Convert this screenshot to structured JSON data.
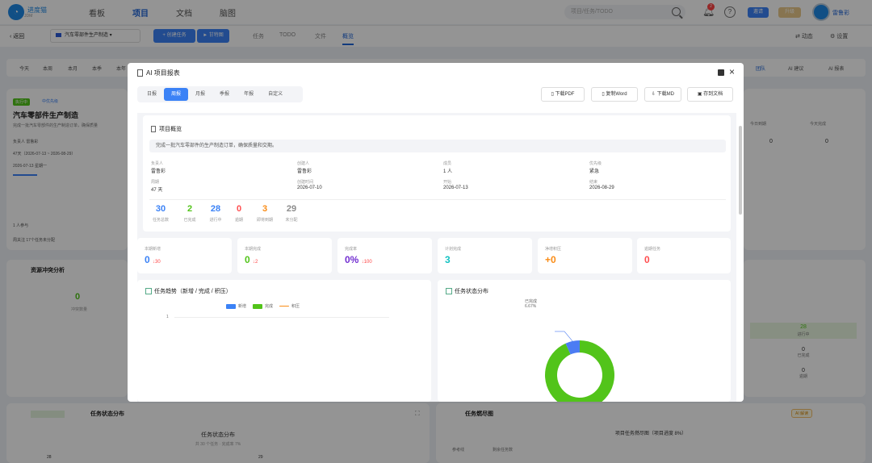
{
  "app": {
    "logo_text": "进度猫",
    "logo_sub": "JDM"
  },
  "nav": {
    "items": [
      "看板",
      "项目",
      "文档",
      "脑图"
    ],
    "active": 1,
    "search_placeholder": "项目/任务/TODO",
    "notif_count": "2",
    "btn_blue": "邀请",
    "btn_gold": "升级",
    "user_name": "雷鲁彩"
  },
  "toolbar": {
    "back": "返回",
    "project": "汽车零部件生产制造",
    "create_task": "+ 创建任务",
    "import": "► 甘特图",
    "tabs": [
      "任务",
      "TODO",
      "文件",
      "概览"
    ],
    "active_tab": 3,
    "right": [
      "动态",
      "设置"
    ]
  },
  "background": {
    "chips": [
      "今天",
      "本周",
      "本月",
      "本季",
      "本年"
    ],
    "right_chips": [
      "团队",
      "AI 建议",
      "AI 报表"
    ],
    "proj_status": "执行中",
    "proj_priority": "中优先级",
    "proj_name": "汽车零部件生产制造",
    "proj_desc": "完成一批汽车零部件的生产制造订单，确保质量",
    "owner_label": "负责人",
    "owner": "雷鲁彩",
    "duration": "47天（2026-07-13 ~ 2026-08-29）",
    "start": "2026-07-13 星期一",
    "members": "1 人参与",
    "focus": "周关注  17个任务未分配",
    "conflict_title": "资源冲突分析",
    "conflict_value": "0",
    "conflict_label": "冲突数量",
    "today_due": "今日到期",
    "today_done": "今天完成",
    "today_due_v": "0",
    "today_done_v": "0",
    "right_stats": [
      {
        "v": "28",
        "l": "进行中"
      },
      {
        "v": "0",
        "l": "已完成"
      },
      {
        "v": "0",
        "l": "逾期"
      }
    ],
    "status_title": "任务状态分布",
    "status_subtitle": "任务状态分布",
    "status_caption": "共 30 个任务 · 完成率 7%",
    "status_ticks": [
      "28",
      "29"
    ],
    "gantt_title": "任务燃尽图",
    "gantt_btn": "AI 解读",
    "gantt_subtitle": "项目任务燃尽图（项目进度 8%）",
    "gantt_legend": [
      "参考线",
      "剩余任务数"
    ]
  },
  "modal": {
    "title": "AI 项目报表",
    "tabs": [
      "日报",
      "周报",
      "月报",
      "季报",
      "年报",
      "自定义"
    ],
    "active_tab": 1,
    "actions": [
      "下载PDF",
      "复制Word",
      "下载MD",
      "存到文档"
    ],
    "overview_title": "项目概览",
    "overview_desc": "完成一批汽车零部件的生产制造订单，确保质量和交期。",
    "meta": [
      {
        "l": "负责人",
        "v": "雷鲁彩"
      },
      {
        "l": "创建人",
        "v": "雷鲁彩"
      },
      {
        "l": "成员",
        "v": "1 人"
      },
      {
        "l": "优先级",
        "v": "紧急"
      },
      {
        "l": "周期",
        "v": "47 天"
      },
      {
        "l": "创建时间",
        "v": "2026-07-10"
      },
      {
        "l": "开始",
        "v": "2026-07-13"
      },
      {
        "l": "结束",
        "v": "2026-08-29"
      }
    ],
    "stats": [
      {
        "v": "30",
        "l": "任务总数",
        "color": "#3b82f6"
      },
      {
        "v": "2",
        "l": "已完成",
        "color": "#52c41a"
      },
      {
        "v": "28",
        "l": "进行中",
        "color": "#3b82f6"
      },
      {
        "v": "0",
        "l": "逾期",
        "color": "#ff4d4f"
      },
      {
        "v": "3",
        "l": "即将到期",
        "color": "#fa8c16"
      },
      {
        "v": "29",
        "l": "未分配",
        "color": "#8c8c8c"
      }
    ],
    "kpis": [
      {
        "l": "本期新增",
        "v": "0",
        "s": "↓30",
        "color": "#3b82f6"
      },
      {
        "l": "本期完成",
        "v": "0",
        "s": "↓2",
        "color": "#52c41a"
      },
      {
        "l": "完成率",
        "v": "0%",
        "s": "↓100",
        "color": "#722ed1"
      },
      {
        "l": "计划完成",
        "v": "3",
        "s": "",
        "color": "#13c2c2"
      },
      {
        "l": "净增积压",
        "v": "+0",
        "s": "",
        "color": "#fa8c16"
      },
      {
        "l": "逾期任务",
        "v": "0",
        "s": "",
        "color": "#ff4d4f"
      }
    ],
    "trend_title": "任务趋势（新增 / 完成 / 积压）",
    "trend_legend": [
      "新增",
      "完成",
      "积压"
    ],
    "trend_colors": [
      "#3b82f6",
      "#52c41a",
      "#fa8c16"
    ],
    "trend_tick": "1",
    "pie_title": "任务状态分布",
    "pie_label_name": "已完成",
    "pie_label_pct": "6.67%",
    "pie_fraction_done": 0.0667,
    "pie_colors": {
      "done": "#4c7cf3",
      "doing": "#52c41a"
    }
  }
}
